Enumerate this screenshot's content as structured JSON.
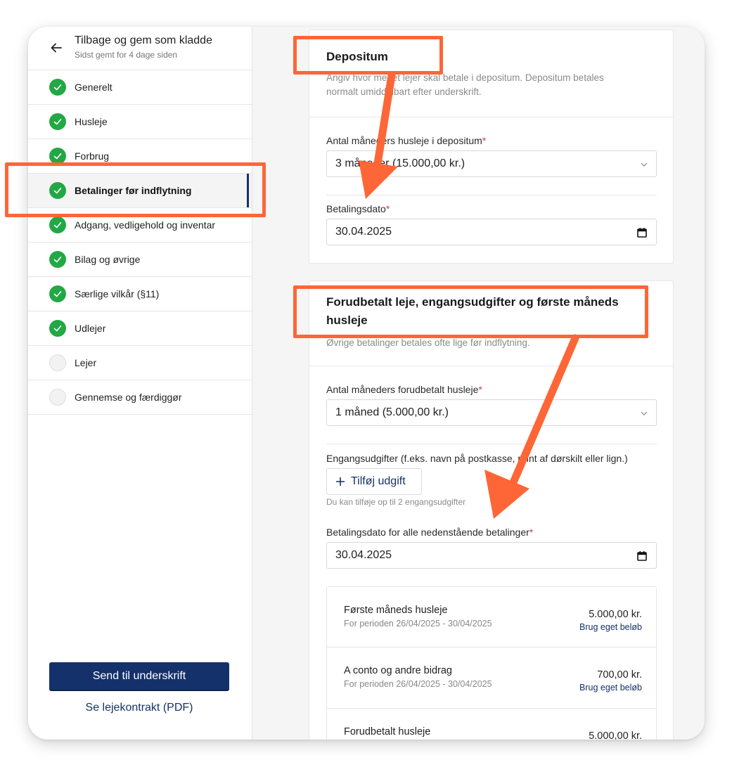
{
  "sidebar": {
    "back": {
      "title": "Tilbage og gem som kladde",
      "subtitle": "Sidst gemt for 4 dage siden"
    },
    "items": [
      {
        "label": "Generelt",
        "status": "done"
      },
      {
        "label": "Husleje",
        "status": "done"
      },
      {
        "label": "Forbrug",
        "status": "done"
      },
      {
        "label": "Betalinger før indflytning",
        "status": "done",
        "active": true
      },
      {
        "label": "Adgang, vedligehold og inventar",
        "status": "done"
      },
      {
        "label": "Bilag og øvrige",
        "status": "done"
      },
      {
        "label": "Særlige vilkår (§11)",
        "status": "done"
      },
      {
        "label": "Udlejer",
        "status": "done"
      },
      {
        "label": "Lejer",
        "status": "pending"
      },
      {
        "label": "Gennemse og færdiggør",
        "status": "pending"
      }
    ],
    "send_label": "Send til underskrift",
    "pdf_label": "Se lejekontrakt (PDF)"
  },
  "deposit": {
    "title": "Depositum",
    "description_line1": "Angiv hvor meget lejer skal betale i depositum. Deposit",
    "description_line1_end": "um betales",
    "description_line2": "normalt umiddelbart efter underskrift.",
    "months_label": "Antal måneders husleje i depositum",
    "months_value": "3 måneder (15.000,00 kr.)",
    "date_label": "Betalingsdato",
    "date_value": "30.04.2025"
  },
  "prepaid": {
    "title_line1": "Forudbetalt leje, engangsudgifter og første måneds",
    "title_line2": "husleje",
    "description": "Øvrige betalinger betales ofte lige før indflytning.",
    "months_label": "Antal måneders forudbetalt husleje",
    "months_value": "1 måned (5.000,00 kr.)",
    "one_time_label": "Engangsudgifter (f.eks. navn på postkasse, print af dørskilt eller lign.)",
    "add_button": "Tilføj udgift",
    "add_hint": "Du kan tilføje op til 2 engangsudgifter",
    "date_label": "Betalingsdato for alle nedenstående betalinger",
    "date_value": "30.04.2025",
    "payments": [
      {
        "name": "Første måneds husleje",
        "period": "For perioden 26/04/2025 - 30/04/2025",
        "amount": "5.000,00 kr.",
        "link": "Brug eget beløb"
      },
      {
        "name": "A conto og andre bidrag",
        "period": "For perioden 26/04/2025 - 30/04/2025",
        "amount": "700,00 kr.",
        "link": "Brug eget beløb"
      },
      {
        "name": "Forudbetalt husleje",
        "period": "",
        "amount": "5.000,00 kr.",
        "link": ""
      }
    ]
  },
  "required_mark": "*",
  "colors": {
    "accent": "#15316b",
    "success": "#22a845",
    "highlight": "#fe6637",
    "required": "#d93a3a"
  },
  "icons": {
    "back": "arrow-left-icon",
    "done": "check-circle-icon",
    "select": "chevron-down-icon",
    "date": "calendar-icon",
    "add": "plus-icon"
  }
}
